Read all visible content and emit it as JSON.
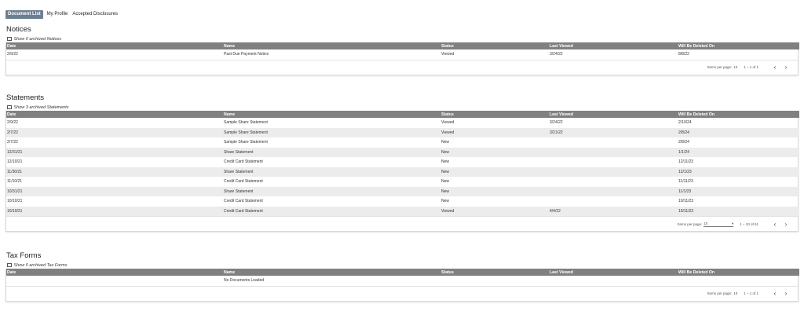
{
  "tabs": [
    {
      "label": "Document List",
      "active": true
    },
    {
      "label": "My Profile",
      "active": false
    },
    {
      "label": "Accepted Disclosures",
      "active": false
    }
  ],
  "columns": [
    "Date",
    "Name",
    "Status",
    "Last Viewed",
    "Will Be Deleted On"
  ],
  "notices": {
    "title": "Notices",
    "archive_label": "Show 0 archived Notices",
    "rows": [
      [
        "2/9/22",
        "Past Due Payment Notice",
        "Viewed",
        "3/24/22",
        "8/8/22"
      ]
    ],
    "paginator": {
      "per_page_label": "Items per page:",
      "per_page": "10",
      "range": "1 – 1 of 1"
    }
  },
  "statements": {
    "title": "Statements",
    "archive_label": "Show 3 archived Statements",
    "rows": [
      [
        "2/9/22",
        "Sample Share Statement",
        "Viewed",
        "3/24/22",
        "2/10/24"
      ],
      [
        "2/7/22",
        "Sample Share Statement",
        "Viewed",
        "3/21/22",
        "2/8/24"
      ],
      [
        "2/7/22",
        "Sample Share Statement",
        "New",
        "",
        "2/8/24"
      ],
      [
        "12/31/21",
        "Share Statement",
        "New",
        "",
        "1/1/24"
      ],
      [
        "12/10/21",
        "Credit Card Statement",
        "New",
        "",
        "12/11/23"
      ],
      [
        "11/30/21",
        "Share Statement",
        "New",
        "",
        "12/1/23"
      ],
      [
        "11/10/21",
        "Credit Card Statement",
        "New",
        "",
        "11/11/23"
      ],
      [
        "10/31/21",
        "Share Statement",
        "New",
        "",
        "11/1/23"
      ],
      [
        "10/10/21",
        "Credit Card Statement",
        "New",
        "",
        "10/11/23"
      ],
      [
        "10/10/21",
        "Credit Card Statement",
        "Viewed",
        "4/4/22",
        "10/11/23"
      ]
    ],
    "paginator": {
      "per_page_label": "Items per page:",
      "per_page": "10",
      "range": "1 – 10 of 61"
    }
  },
  "tax_forms": {
    "title": "Tax Forms",
    "archive_label": "Show 0 archived Tax Forms",
    "empty_message": "No Documents Loaded",
    "paginator": {
      "per_page_label": "Items per page:",
      "per_page": "10",
      "range": "1 – 1 of 1"
    }
  },
  "icons": {
    "prev": "chevron-left-icon",
    "next": "chevron-right-icon",
    "dropdown": "caret-down-icon"
  },
  "colors": {
    "header_bg": "#808080",
    "active_tab_bg": "#6e7f92",
    "alt_row_bg": "#ececec"
  }
}
